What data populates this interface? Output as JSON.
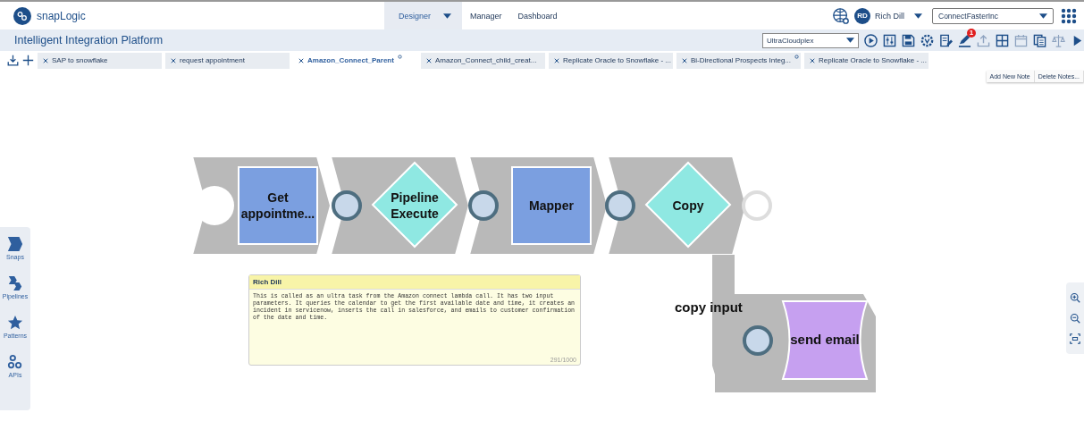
{
  "header": {
    "logo_text": "snapLogic",
    "nav": [
      {
        "label": "Designer",
        "selected": true,
        "dropdown": true
      },
      {
        "label": "Manager",
        "selected": false,
        "dropdown": false
      },
      {
        "label": "Dashboard",
        "selected": false,
        "dropdown": false
      }
    ],
    "user": {
      "initials": "RD",
      "name": "Rich Dill"
    },
    "org": "ConnectFasterInc"
  },
  "title": "Intelligent Integration Platform",
  "toolbar": {
    "snaplex": "UltraCloudplex",
    "badge": "1"
  },
  "tabs": [
    {
      "label": "SAP to snowflake",
      "selected": false,
      "modified": false
    },
    {
      "label": "request appointment",
      "selected": false,
      "modified": false
    },
    {
      "label": "Amazon_Connect_Parent",
      "selected": true,
      "modified": true
    },
    {
      "label": "Amazon_Connect_child_creat...",
      "selected": false,
      "modified": false
    },
    {
      "label": "Replicate Oracle to Snowflake - ...",
      "selected": false,
      "modified": false
    },
    {
      "label": "Bi-Directional Prospects Integ...",
      "selected": false,
      "modified": true
    },
    {
      "label": "Replicate Oracle to Snowflake - ...",
      "selected": false,
      "modified": false
    }
  ],
  "note_buttons": [
    "Add New Note",
    "Delete Notes..."
  ],
  "pipeline": {
    "snaps": [
      {
        "label": "Get appointme...",
        "kind": "read",
        "output_connected": true
      },
      {
        "label": "Pipeline Execute",
        "kind": "flow",
        "output_connected": true
      },
      {
        "label": "Mapper",
        "kind": "transform",
        "output_connected": true
      },
      {
        "label": "Copy",
        "kind": "flow",
        "output_connected": false
      }
    ],
    "branch": {
      "label": "copy input",
      "snap": {
        "label": "send email",
        "kind": "write",
        "input_connected": true
      }
    }
  },
  "note": {
    "author": "Rich Dill",
    "text": "This is called as an ultra task from the Amazon connect lambda call. It has two input parameters. It queries the calendar to get the first available date and time, it creates an incident in servicenow, inserts the call in salesforce, and emails to customer confirmation of the date and time.",
    "counter": "291/1000"
  },
  "sidebar": [
    {
      "label": "Snaps",
      "kind": "snaps"
    },
    {
      "label": "Pipelines",
      "kind": "pipelines"
    },
    {
      "label": "Patterns",
      "kind": "patterns"
    },
    {
      "label": "APIs",
      "kind": "apis"
    }
  ]
}
